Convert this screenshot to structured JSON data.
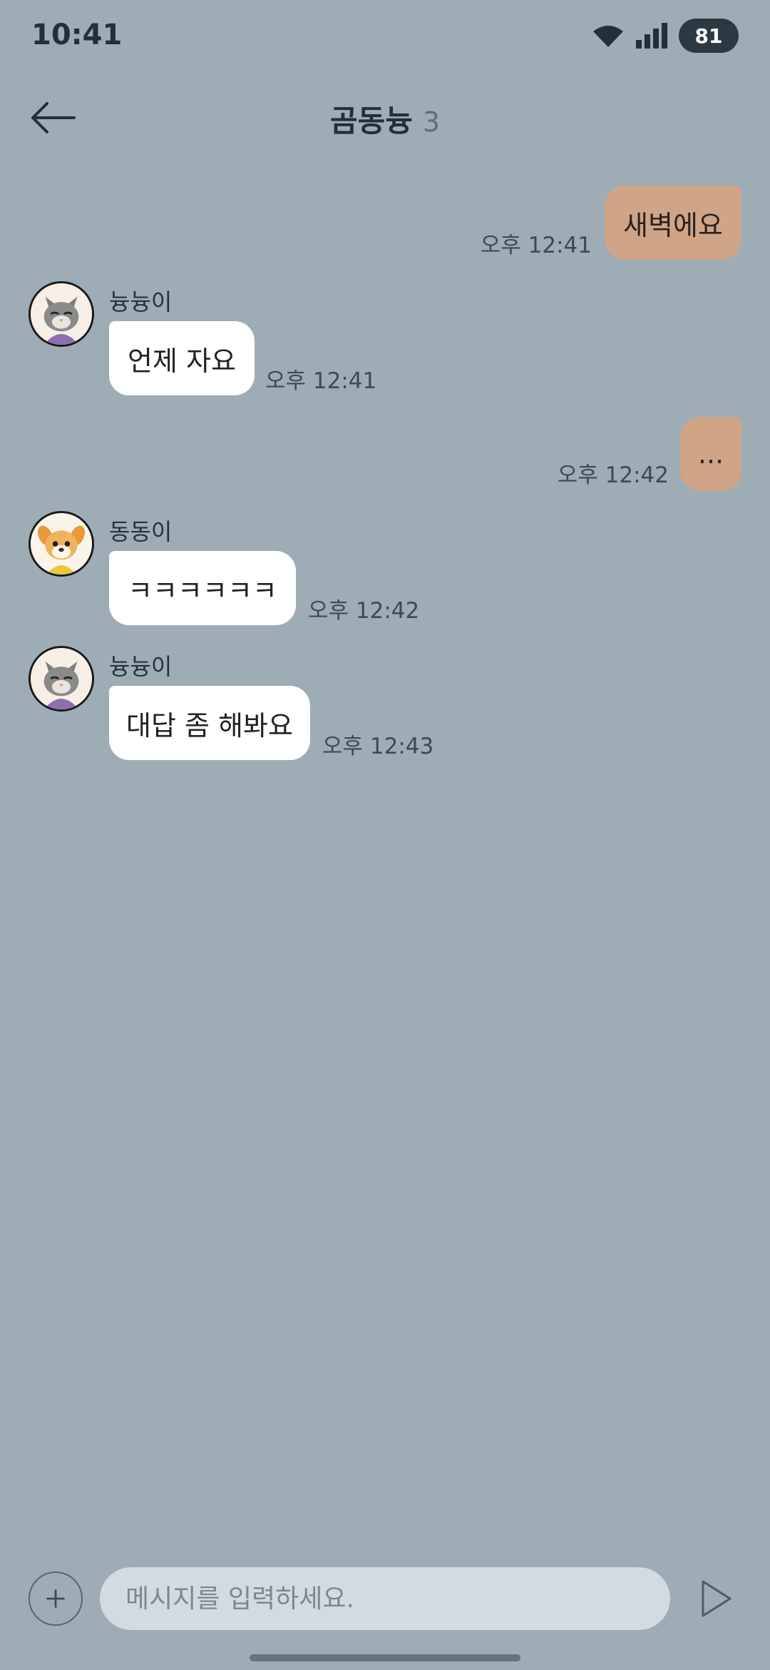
{
  "status_bar": {
    "time": "10:41",
    "battery": "81"
  },
  "header": {
    "title": "곰동늉",
    "member_count": "3"
  },
  "messages": [
    {
      "side": "out",
      "text": "새벽에요",
      "time": "오후 12:41"
    },
    {
      "side": "in",
      "sender": "늉늉이",
      "text": "언제 자요",
      "time": "오후 12:41"
    },
    {
      "side": "out",
      "text": "...",
      "time": "오후 12:42"
    },
    {
      "side": "in",
      "sender": "동동이",
      "text": "ㅋㅋㅋㅋㅋㅋ",
      "time": "오후 12:42"
    },
    {
      "side": "in",
      "sender": "늉늉이",
      "text": "대답 좀 해봐요",
      "time": "오후 12:43"
    }
  ],
  "input": {
    "placeholder": "메시지를 입력하세요."
  },
  "colors": {
    "background": "#9eacb5",
    "outgoing_bubble": "#d0a487",
    "incoming_bubble": "#ffffff"
  }
}
